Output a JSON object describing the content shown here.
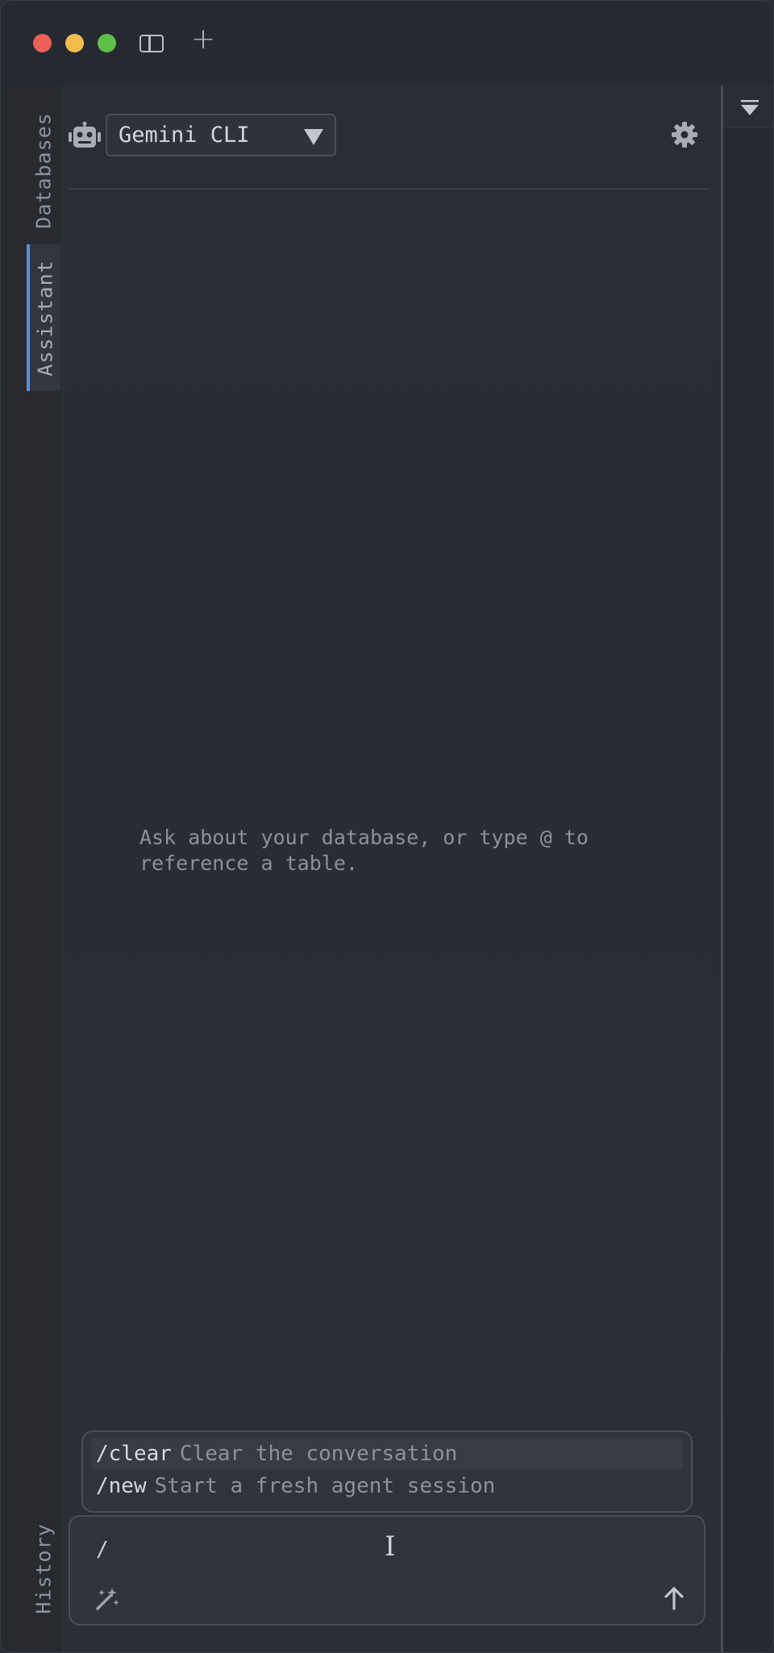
{
  "window": {
    "controls": [
      "close",
      "minimize",
      "zoom"
    ],
    "toolbar_icons": [
      "sidebar-toggle-icon",
      "plus-icon"
    ]
  },
  "rail": {
    "tabs": [
      {
        "label": "Databases",
        "active": false
      },
      {
        "label": "Assistant",
        "active": true
      },
      {
        "label": "History",
        "active": false
      }
    ]
  },
  "assistant": {
    "agent_select_value": "Gemini CLI",
    "empty_hint": "Ask about your database, or type @ to reference a table.",
    "slash_commands": [
      {
        "name": "/clear",
        "description": "Clear the conversation"
      },
      {
        "name": "/new",
        "description": "Start a fresh agent session"
      }
    ],
    "input_value": "/"
  },
  "colors": {
    "accent": "#5e8fd6",
    "traffic_red": "#ec5f57",
    "traffic_yellow": "#f3bd4e",
    "traffic_green": "#5cc147"
  }
}
